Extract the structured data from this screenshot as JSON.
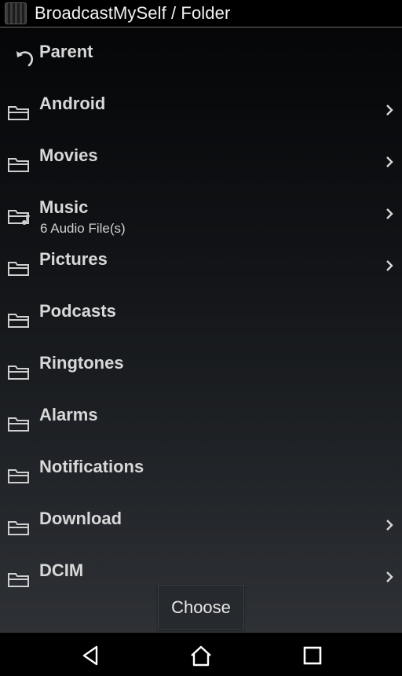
{
  "window": {
    "title": "BroadcastMySelf / Folder"
  },
  "list": {
    "parent_label": "Parent",
    "items": [
      {
        "label": "Android",
        "sub": "",
        "icon": "folder-icon",
        "chevron": true
      },
      {
        "label": "Movies",
        "sub": "",
        "icon": "folder-icon",
        "chevron": true
      },
      {
        "label": "Music",
        "sub": "6 Audio File(s)",
        "icon": "music-folder-icon",
        "chevron": true
      },
      {
        "label": "Pictures",
        "sub": "",
        "icon": "folder-icon",
        "chevron": true
      },
      {
        "label": "Podcasts",
        "sub": "",
        "icon": "folder-icon",
        "chevron": false
      },
      {
        "label": "Ringtones",
        "sub": "",
        "icon": "folder-icon",
        "chevron": false
      },
      {
        "label": "Alarms",
        "sub": "",
        "icon": "folder-icon",
        "chevron": false
      },
      {
        "label": "Notifications",
        "sub": "",
        "icon": "folder-icon",
        "chevron": false
      },
      {
        "label": "Download",
        "sub": "",
        "icon": "folder-icon",
        "chevron": true
      },
      {
        "label": "DCIM",
        "sub": "",
        "icon": "folder-icon",
        "chevron": true
      }
    ]
  },
  "actions": {
    "choose_label": "Choose"
  },
  "navbar": {
    "icons": [
      "back-icon",
      "home-icon",
      "recents-icon"
    ]
  },
  "colors": {
    "background": "#000000",
    "text": "#d8d8d8",
    "divider": "#6a6a6a"
  }
}
